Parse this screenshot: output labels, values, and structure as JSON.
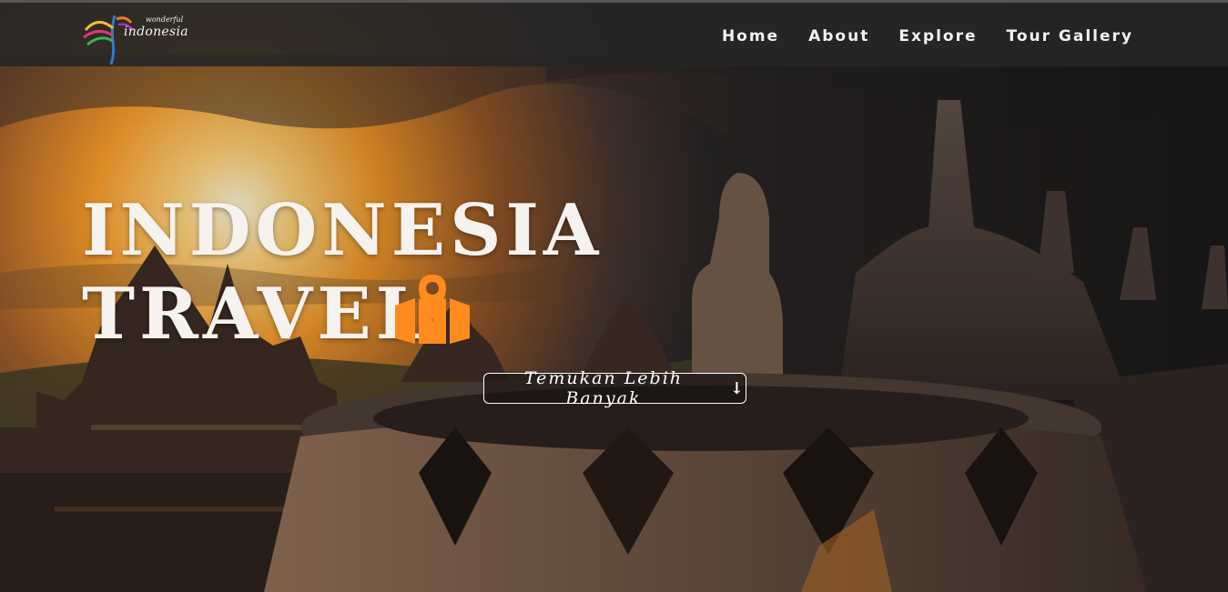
{
  "brand": {
    "logo_small": "wonderful",
    "logo_main": "indonesia"
  },
  "nav": {
    "items": [
      "Home",
      "About",
      "Explore",
      "Tour Gallery"
    ]
  },
  "hero": {
    "title_line1": "INDONESIA",
    "title_line2": "TRAVEL",
    "cta_label": "Temukan Lebih Banyak",
    "cta_icon": "arrow-down-icon",
    "title_icon": "map-marker-icon"
  },
  "colors": {
    "accent_orange": "#ff8a1e",
    "nav_bg": "#262626",
    "text_light": "#f6f2ee"
  }
}
